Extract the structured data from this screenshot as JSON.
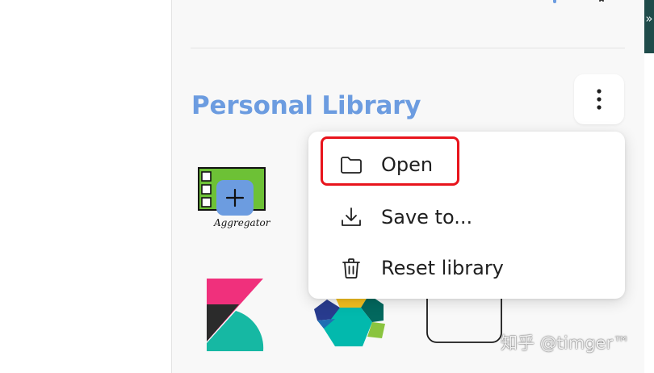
{
  "library": {
    "title": "Personal Library"
  },
  "menu": {
    "items": [
      {
        "label": "Open",
        "icon": "folder-icon"
      },
      {
        "label": "Save to...",
        "icon": "download-icon"
      },
      {
        "label": "Reset library",
        "icon": "trash-icon"
      }
    ]
  },
  "library_items": [
    {
      "name": "Aggregator",
      "icon": "aggregator-sketch"
    },
    {
      "name": "",
      "icon": "kibana-logo"
    },
    {
      "name": "",
      "icon": "elastic-logo"
    },
    {
      "name": "",
      "icon": "rounded-rectangle"
    }
  ],
  "watermark": {
    "text": "知乎 @timger™"
  },
  "colors": {
    "title": "#6c9ce0",
    "highlight": "#e8141c",
    "panel_bg": "#f8f8f8",
    "accent_blue": "#6c9ce0"
  }
}
